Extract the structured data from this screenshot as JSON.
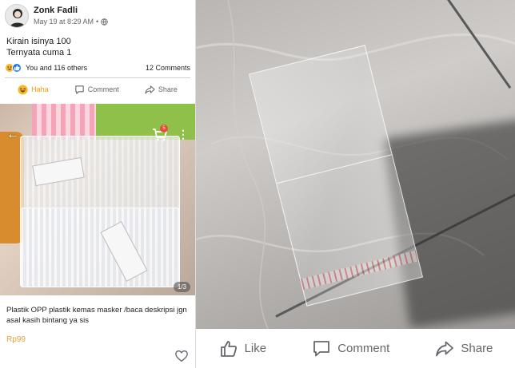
{
  "post": {
    "author": "Zonk Fadli",
    "timestamp": "May 19 at 8:29 AM",
    "separator": "•",
    "privacy_icon": "globe-icon",
    "text_line1": "Kirain isinya 100",
    "text_line2": "Ternyata cuma 1",
    "reactions_text": "You and 116 others",
    "comments_count": "12 Comments",
    "actions": {
      "haha_label": "Haha",
      "comment_label": "Comment",
      "share_label": "Share"
    }
  },
  "product": {
    "page_indicator": "1/3",
    "title": "Plastik OPP plastik kemas masker /baca deskripsi jgn asal kasih bintang ya sis",
    "price": "Rp99",
    "cart_badge": "5"
  },
  "photo_actions": {
    "like_label": "Like",
    "comment_label": "Comment",
    "share_label": "Share"
  },
  "colors": {
    "facebook_blue": "#1877f2",
    "haha_yellow": "#f7b928",
    "price_orange": "#e6a23c",
    "muted_gray": "#65676b"
  }
}
